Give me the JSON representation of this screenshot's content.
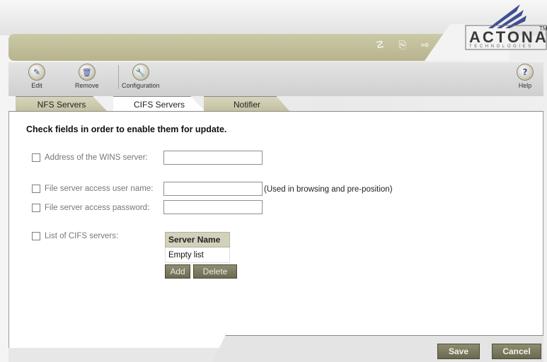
{
  "brand": {
    "logo_text": "ACTONA",
    "logo_tm": "TM",
    "logo_sub": "TECHNOLOGIES"
  },
  "header_icons": [
    {
      "name": "refresh-icon",
      "glyph": "☡"
    },
    {
      "name": "monitor-icon",
      "glyph": "⎘"
    },
    {
      "name": "logout-icon",
      "glyph": "⇨"
    }
  ],
  "toolbar": {
    "edit_label": "Edit",
    "remove_label": "Remove",
    "configuration_label": "Configuration",
    "help_label": "Help",
    "edit_glyph": "✎",
    "remove_glyph": "🗑",
    "configuration_glyph": "🔧",
    "help_glyph": "?"
  },
  "tabs": [
    {
      "label": "NFS Servers",
      "active": false
    },
    {
      "label": "CIFS Servers",
      "active": true
    },
    {
      "label": "Notifier",
      "active": false
    }
  ],
  "form": {
    "heading": "Check fields in order to enable them for update.",
    "wins_label": "Address of the WINS server:",
    "wins_value": "",
    "user_label": "File server access user name:",
    "user_value": "",
    "user_hint": "(Used in browsing and pre-position)",
    "password_label": "File server access password:",
    "password_value": "",
    "cifs_list_label": "List of CIFS servers:"
  },
  "server_table": {
    "column_header": "Server Name",
    "rows": [
      "Empty list"
    ],
    "add_label": "Add",
    "delete_label": "Delete"
  },
  "actions": {
    "save_label": "Save",
    "cancel_label": "Cancel"
  },
  "colors": {
    "olive_band": "#c3c0a0",
    "button_dark": "#6c6a52",
    "label_gray": "#777777"
  }
}
